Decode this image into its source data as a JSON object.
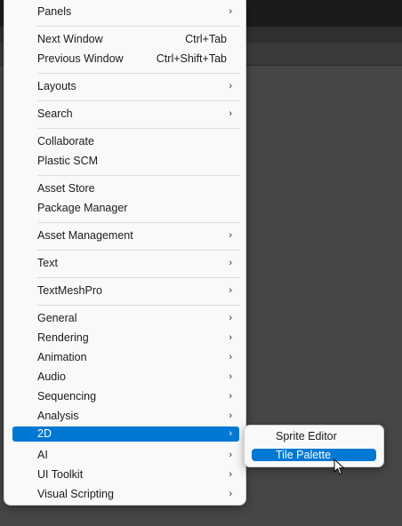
{
  "menu": {
    "items": [
      {
        "label": "Panels",
        "has_submenu": true
      },
      {
        "label": "Next Window",
        "shortcut": "Ctrl+Tab"
      },
      {
        "label": "Previous Window",
        "shortcut": "Ctrl+Shift+Tab"
      },
      {
        "label": "Layouts",
        "has_submenu": true
      },
      {
        "label": "Search",
        "has_submenu": true
      },
      {
        "label": "Collaborate"
      },
      {
        "label": "Plastic SCM"
      },
      {
        "label": "Asset Store"
      },
      {
        "label": "Package Manager"
      },
      {
        "label": "Asset Management",
        "has_submenu": true
      },
      {
        "label": "Text",
        "has_submenu": true
      },
      {
        "label": "TextMeshPro",
        "has_submenu": true
      },
      {
        "label": "General",
        "has_submenu": true
      },
      {
        "label": "Rendering",
        "has_submenu": true
      },
      {
        "label": "Animation",
        "has_submenu": true
      },
      {
        "label": "Audio",
        "has_submenu": true
      },
      {
        "label": "Sequencing",
        "has_submenu": true
      },
      {
        "label": "Analysis",
        "has_submenu": true
      },
      {
        "label": "2D",
        "has_submenu": true,
        "highlighted": true
      },
      {
        "label": "AI",
        "has_submenu": true
      },
      {
        "label": "UI Toolkit",
        "has_submenu": true
      },
      {
        "label": "Visual Scripting",
        "has_submenu": true
      }
    ],
    "arrow_glyph": "›"
  },
  "submenu": {
    "items": [
      {
        "label": "Sprite Editor"
      },
      {
        "label": "Tile Palette",
        "highlighted": true
      }
    ]
  },
  "colors": {
    "menu_bg": "#f9f9f9",
    "highlight": "#0078d4",
    "highlight_text": "#ffffff",
    "text": "#1b1b1b",
    "separator": "#dcdcdc",
    "editor_bg": "#464646"
  },
  "icons": {
    "submenu_arrow": "chevron-right-icon",
    "cursor": "mouse-pointer-icon"
  }
}
